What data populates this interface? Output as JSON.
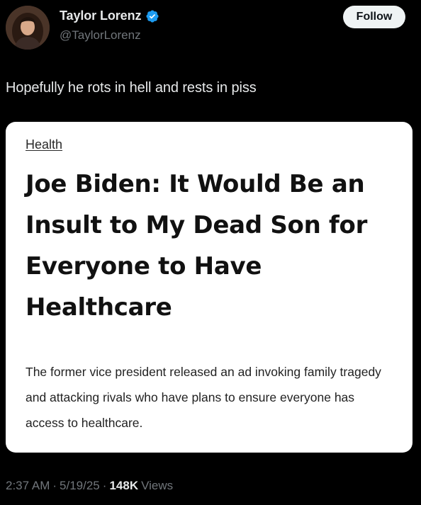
{
  "author": {
    "display_name": "Taylor Lorenz",
    "handle": "@TaylorLorenz",
    "verified": true,
    "avatar": "profile-photo"
  },
  "follow_button": {
    "label": "Follow"
  },
  "tweet": {
    "text": "Hopefully he rots in hell and rests in piss"
  },
  "article_card": {
    "category": "Health",
    "headline": "Joe Biden: It Would Be an Insult to My Dead Son for Everyone to Have Healthcare",
    "summary": "The former vice president released an ad invoking family tragedy and attacking rivals who have plans to ensure everyone has access to healthcare."
  },
  "meta": {
    "time": "2:37 AM",
    "separator": "·",
    "date": "5/19/25",
    "views_count": "148K",
    "views_label": "Views"
  },
  "colors": {
    "background": "#000000",
    "text_primary": "#e7e9ea",
    "text_secondary": "#71767b",
    "verified_badge": "#1d9bf0",
    "follow_button_bg": "#eff3f4",
    "card_bg": "#ffffff"
  }
}
